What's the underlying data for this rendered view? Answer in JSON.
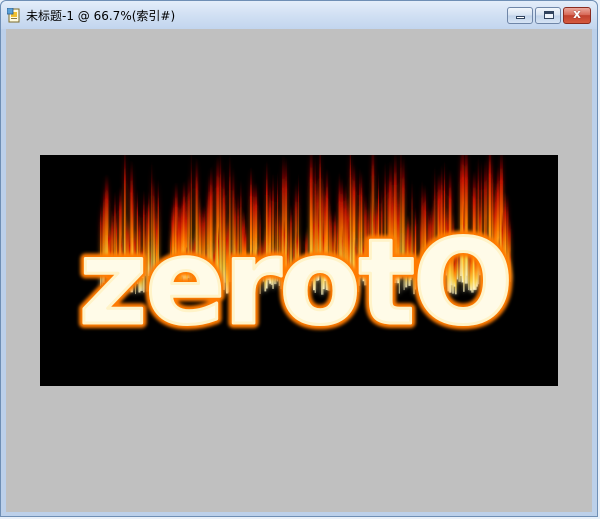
{
  "window": {
    "title": "未标题-1 @ 66.7%(索引#)",
    "icon": "document-image-icon"
  },
  "controls": {
    "minimize_icon": "minimize-icon",
    "maximize_icon": "restore-icon",
    "close_icon": "close-icon",
    "close_glyph": "x"
  },
  "canvas": {
    "text": "zerotO",
    "background": "#000000",
    "text_color": "#fffbe8",
    "flame_colors": [
      "#fff6c8",
      "#ffd23a",
      "#ff7a00",
      "#c81400",
      "#500000"
    ]
  },
  "colors": {
    "workspace": "#c0c0c0",
    "titlebar": "#d1e0f3"
  }
}
